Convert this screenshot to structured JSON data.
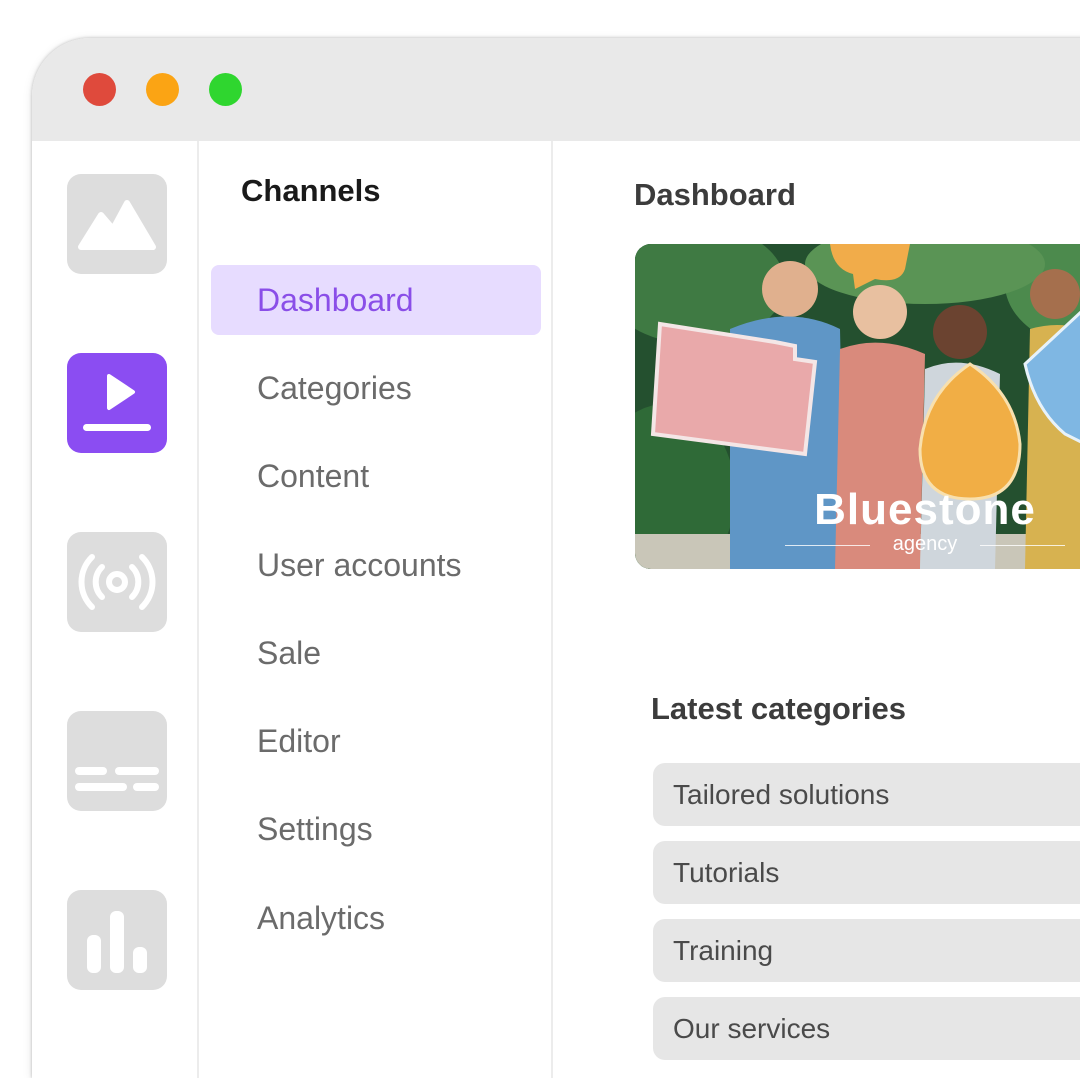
{
  "window": {
    "controls": [
      "close",
      "minimize",
      "maximize"
    ]
  },
  "rail": {
    "items": [
      {
        "icon": "mountain-image-icon",
        "active": false
      },
      {
        "icon": "play-video-icon",
        "active": true
      },
      {
        "icon": "broadcast-icon",
        "active": false
      },
      {
        "icon": "subtitles-icon",
        "active": false
      },
      {
        "icon": "bar-chart-icon",
        "active": false
      }
    ]
  },
  "channels": {
    "title": "Channels",
    "items": [
      {
        "label": "Dashboard",
        "active": true
      },
      {
        "label": "Categories"
      },
      {
        "label": "Content"
      },
      {
        "label": "User accounts"
      },
      {
        "label": "Sale"
      },
      {
        "label": "Editor"
      },
      {
        "label": "Settings"
      },
      {
        "label": "Analytics"
      }
    ]
  },
  "main": {
    "title": "Dashboard",
    "hero": {
      "brand_name": "Bluestone",
      "brand_sub": "agency"
    },
    "latest_title": "Latest categories",
    "categories": [
      "Tailored solutions",
      "Tutorials",
      "Training",
      "Our services"
    ]
  },
  "colors": {
    "accent": "#8b4df2",
    "accent_light": "#e7dcff",
    "close": "#df4a3c",
    "minimize": "#fba414",
    "maximize": "#2fd62f"
  }
}
